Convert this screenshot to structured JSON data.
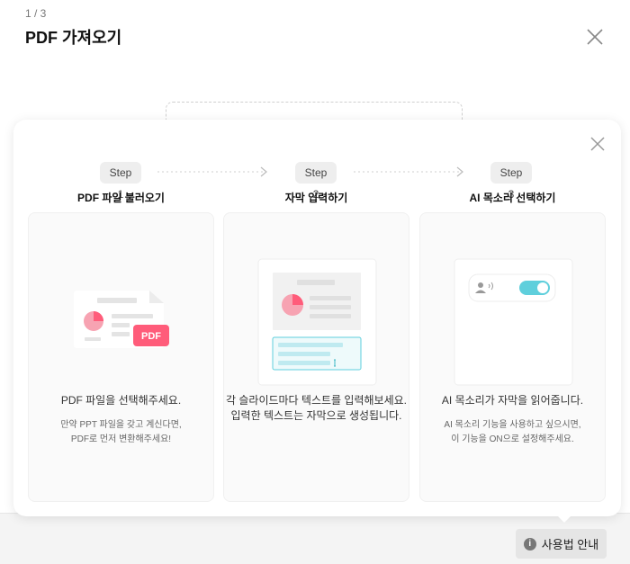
{
  "base": {
    "page_indicator": "1 / 3",
    "title": "PDF 가져오기"
  },
  "guide": {
    "steps": [
      {
        "pill": "Step 1",
        "title": "PDF 파일 불러오기",
        "desc_lines": [
          "PDF 파일을 선택해주세요."
        ],
        "sub_lines": [
          "만약 PPT 파일을 갖고 계신다면,",
          "PDF로 먼저 변환해주세요!"
        ],
        "badge": "PDF"
      },
      {
        "pill": "Step 2",
        "title": "자막 입력하기",
        "desc_lines": [
          "각 슬라이드마다 텍스트를 입력해보세요.",
          "입력한 텍스트는 자막으로 생성됩니다."
        ],
        "sub_lines": []
      },
      {
        "pill": "Step 3",
        "title": "AI 목소리 선택하기",
        "desc_lines": [
          "AI 목소리가 자막을 읽어줍니다."
        ],
        "sub_lines": [
          "AI 목소리 기능을 사용하고 싶으시면,",
          "이 기능을 ON으로 설정해주세요."
        ],
        "toggle_on": true
      }
    ],
    "colors": {
      "accent_pink": "#ff5c7a",
      "pie_pink": "#f7a3b2",
      "accent_teal": "#5fcfdc",
      "cursor_teal": "#3db8c6"
    }
  },
  "help_button": {
    "label": "사용법 안내",
    "icon": "info-icon"
  }
}
